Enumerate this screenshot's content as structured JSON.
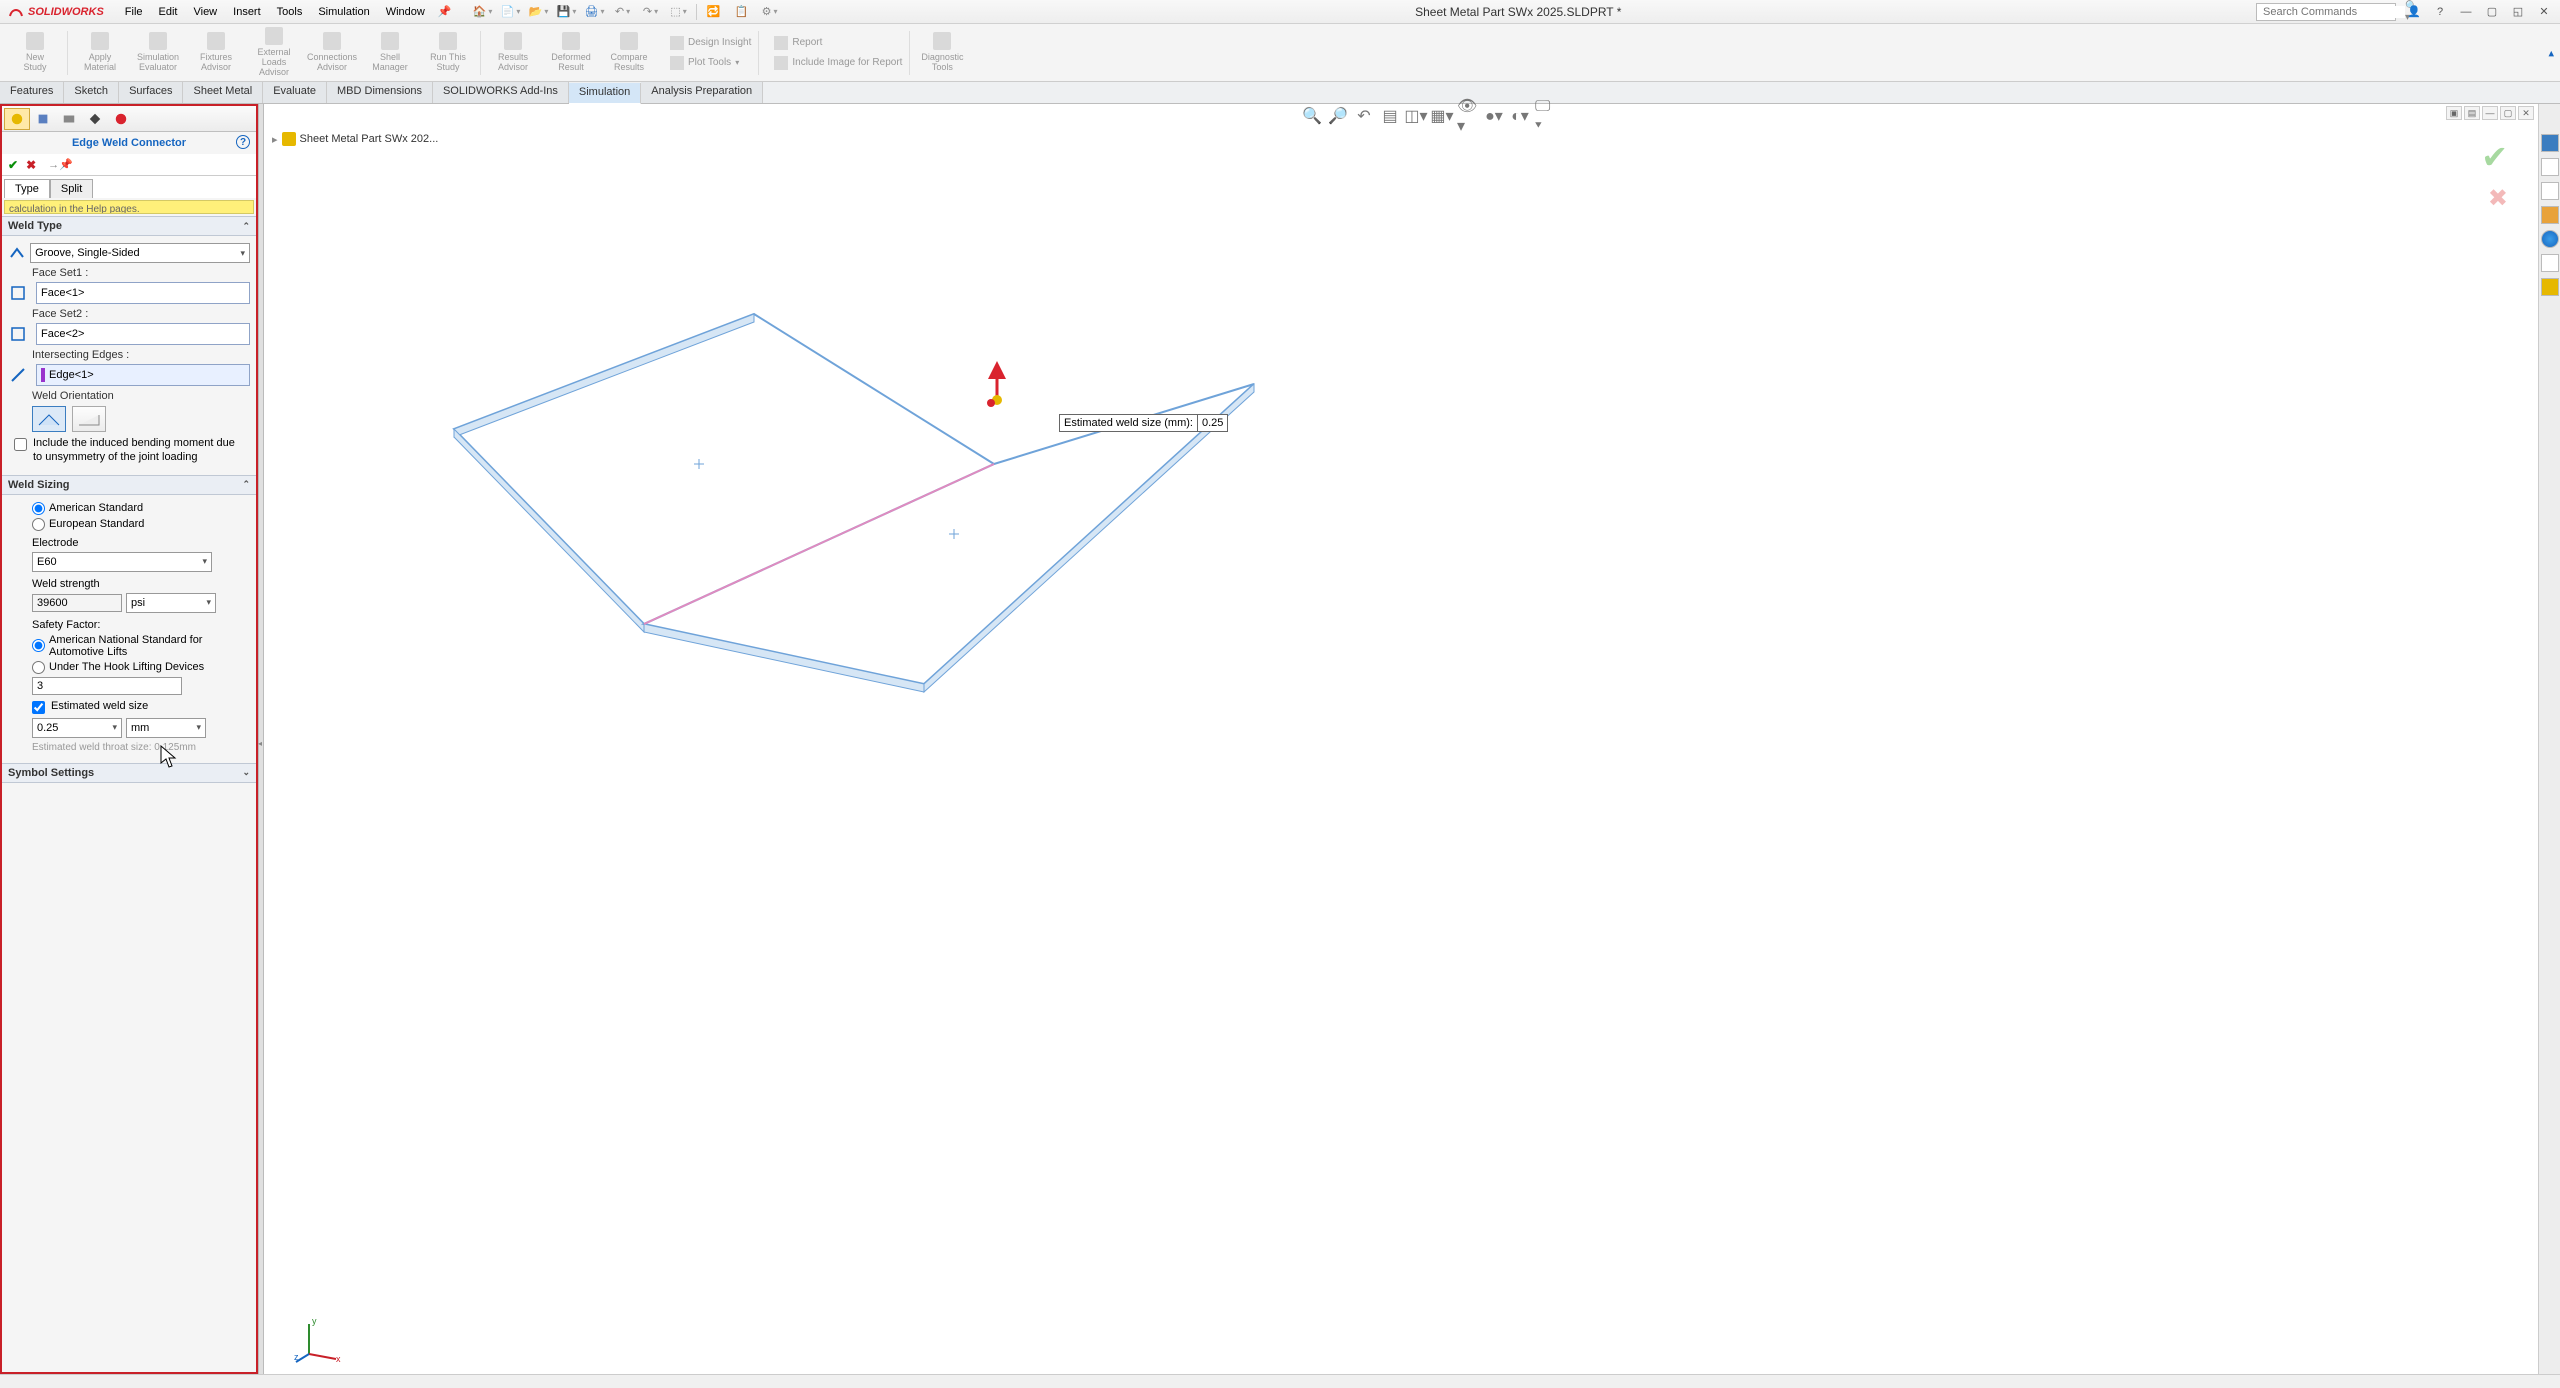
{
  "app": {
    "brand": "SOLIDWORKS",
    "doc_title": "Sheet Metal Part SWx 2025.SLDPRT *",
    "menus": [
      "File",
      "Edit",
      "View",
      "Insert",
      "Tools",
      "Simulation",
      "Window"
    ],
    "search_placeholder": "Search Commands"
  },
  "ribbon": {
    "buttons": [
      {
        "l1": "New",
        "l2": "Study"
      },
      {
        "l1": "Apply",
        "l2": "Material"
      },
      {
        "l1": "Simulation",
        "l2": "Evaluator"
      },
      {
        "l1": "Fixtures",
        "l2": "Advisor"
      },
      {
        "l1": "External Loads",
        "l2": "Advisor"
      },
      {
        "l1": "Connections",
        "l2": "Advisor"
      },
      {
        "l1": "Shell",
        "l2": "Manager"
      },
      {
        "l1": "Run This",
        "l2": "Study"
      },
      {
        "l1": "Results",
        "l2": "Advisor"
      },
      {
        "l1": "Deformed",
        "l2": "Result"
      },
      {
        "l1": "Compare",
        "l2": "Results"
      }
    ],
    "side": [
      {
        "label": "Design Insight"
      },
      {
        "label": "Plot Tools"
      }
    ],
    "side2": [
      {
        "label": "Report"
      },
      {
        "label": "Include Image for Report"
      }
    ],
    "diag": {
      "l1": "Diagnostic",
      "l2": "Tools"
    }
  },
  "tabs": [
    "Features",
    "Sketch",
    "Surfaces",
    "Sheet Metal",
    "Evaluate",
    "MBD Dimensions",
    "SOLIDWORKS Add-Ins",
    "Simulation",
    "Analysis Preparation"
  ],
  "active_tab": "Simulation",
  "breadcrumb": "Sheet Metal Part SWx 202...",
  "panel": {
    "title": "Edge Weld Connector",
    "subtabs": [
      "Type",
      "Split"
    ],
    "active_subtab": "Type",
    "yellow_msg": "calculation in the Help pages.",
    "weld_type": {
      "head": "Weld Type",
      "dropdown": "Groove, Single-Sided",
      "face1_label": "Face Set1 :",
      "face1_val": "Face<1>",
      "face2_label": "Face Set2 :",
      "face2_val": "Face<2>",
      "edges_label": "Intersecting Edges :",
      "edges_val": "Edge<1>",
      "orient_label": "Weld Orientation",
      "bending_label": "Include the induced bending moment due to unsymmetry of the joint loading"
    },
    "weld_sizing": {
      "head": "Weld Sizing",
      "radio1": "American Standard",
      "radio2": "European Standard",
      "electrode_label": "Electrode",
      "electrode_val": "E60",
      "strength_label": "Weld strength",
      "strength_val": "39600",
      "strength_unit": "psi",
      "safety_label": "Safety Factor:",
      "safety_r1": "American National Standard for Automotive Lifts",
      "safety_r2": "Under The Hook Lifting Devices",
      "safety_val": "3",
      "est_label": "Estimated weld size",
      "est_val": "0.25",
      "est_unit": "mm",
      "throat_note": "Estimated weld throat size: 0.125mm"
    },
    "symbol_head": "Symbol Settings"
  },
  "callout": {
    "label": "Estimated weld size (mm):",
    "value": "0.25"
  }
}
